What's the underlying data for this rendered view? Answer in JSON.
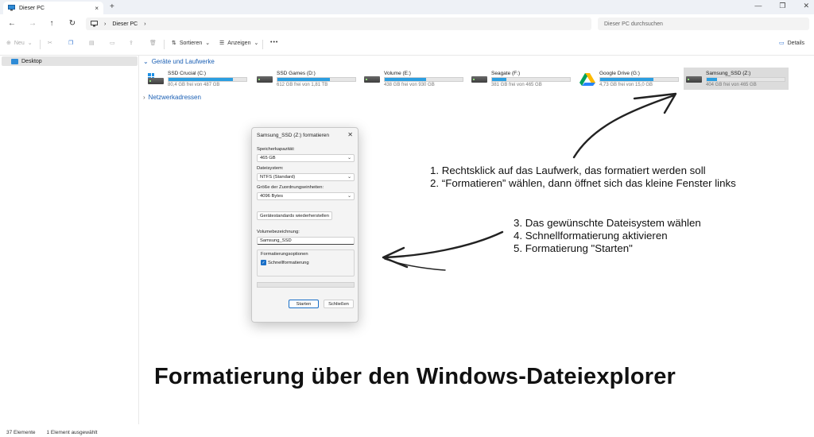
{
  "window": {
    "tab_title": "Dieser PC",
    "tab_close": "×",
    "tab_add": "+",
    "controls": [
      "—",
      "❐",
      "✕"
    ]
  },
  "nav": {
    "breadcrumb_root_chevron": "›",
    "breadcrumb": [
      "Dieser PC",
      "›"
    ],
    "search_placeholder": "Dieser PC durchsuchen"
  },
  "toolbar": {
    "new_label": "Neu",
    "sort_label": "Sortieren",
    "view_label": "Anzeigen",
    "more_label": "•••",
    "details_label": "Details"
  },
  "sidebar": {
    "items": [
      {
        "label": "Desktop"
      }
    ]
  },
  "content": {
    "section_title": "Geräte und Laufwerke",
    "network_title": "Netzwerkadressen",
    "drives": [
      {
        "name": "SSD Crucial (C:)",
        "free": "80,4 GB frei von 487 GB",
        "used_fraction": 0.83,
        "icon": "windows-drive-icon"
      },
      {
        "name": "SSD Games (D:)",
        "free": "612 GB frei von 1,81 TB",
        "used_fraction": 0.67,
        "icon": "hdd-icon"
      },
      {
        "name": "Volume (E:)",
        "free": "438 GB frei von 930 GB",
        "used_fraction": 0.53,
        "icon": "hdd-icon"
      },
      {
        "name": "Seagate (F:)",
        "free": "381 GB frei von 465 GB",
        "used_fraction": 0.18,
        "icon": "hdd-icon"
      },
      {
        "name": "Google Drive (G:)",
        "free": "4,73 GB frei von 15,0 GB",
        "used_fraction": 0.68,
        "icon": "google-drive-icon"
      },
      {
        "name": "Samsung_SSD (Z:)",
        "free": "404 GB frei von 465 GB",
        "used_fraction": 0.13,
        "icon": "hdd-icon"
      }
    ]
  },
  "dialog": {
    "title": "Samsung_SSD (Z:) formatieren",
    "close": "✕",
    "capacity_label": "Speicherkapazität:",
    "capacity_value": "465 GB",
    "fs_label": "Dateisystem:",
    "fs_value": "NTFS (Standard)",
    "alloc_label": "Größe der Zuordnungseinheiten:",
    "alloc_value": "4096 Bytes",
    "restore_label": "Gerätestandards wiederherstellen",
    "volume_label": "Volumebezeichnung:",
    "volume_value": "Samsung_SSD",
    "options_title": "Formatierungsoptionen",
    "quick_format_label": "Schnellformatierung",
    "quick_format_checked": true,
    "start_label": "Starten",
    "close_label": "Schließen"
  },
  "annotations": {
    "step1": "1. Rechtsklick auf das Laufwerk, das formatiert werden soll",
    "step2": "2. “Formatieren” wählen, dann öffnet sich das kleine Fenster links",
    "step3": "3. Das gewünschte Dateisystem wählen",
    "step4": "4. Schnellformatierung aktivieren",
    "step5": "5. Formatierung \"Starten\"",
    "title": "Formatierung über den Windows-Dateiexplorer"
  },
  "status": {
    "count": "37 Elemente",
    "selected": "1 Element ausgewählt"
  }
}
